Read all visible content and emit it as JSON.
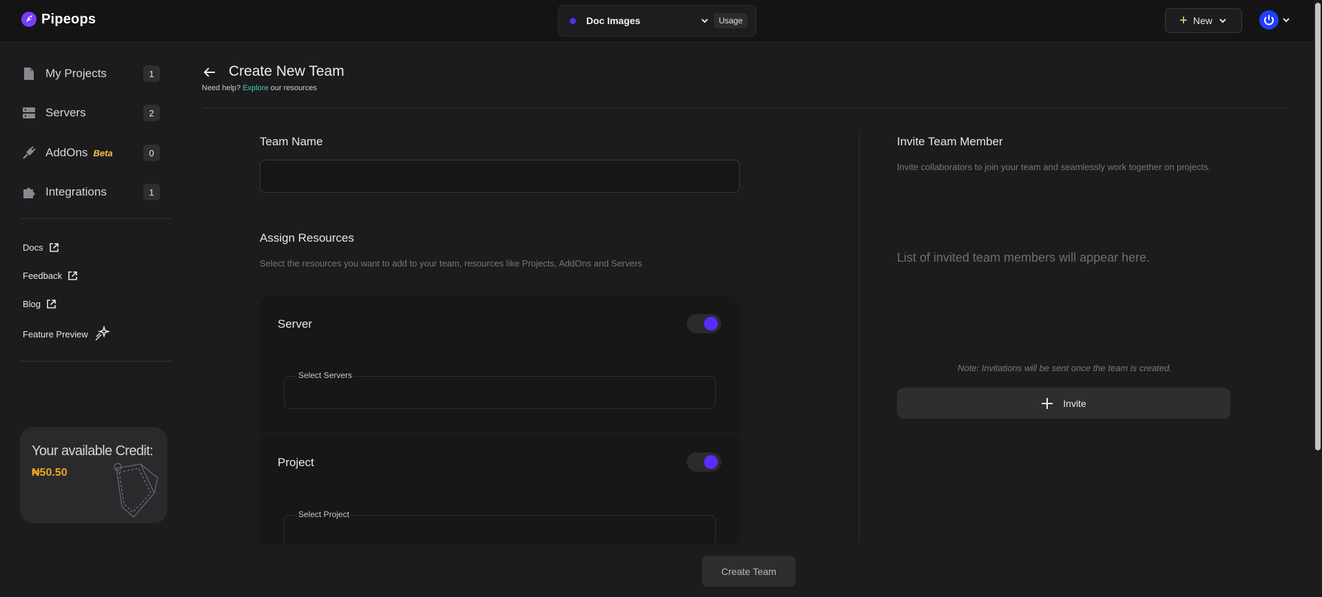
{
  "header": {
    "brand": "Pipeops",
    "project_switcher": {
      "name": "Doc Images",
      "usage_label": "Usage"
    },
    "new_button": "New"
  },
  "sidebar": {
    "nav": [
      {
        "label": "My Projects",
        "count": "1",
        "icon": "file-icon"
      },
      {
        "label": "Servers",
        "count": "2",
        "icon": "server-icon"
      },
      {
        "label": "AddOns",
        "badge": "Beta",
        "count": "0",
        "icon": "plug-icon"
      },
      {
        "label": "Integrations",
        "count": "1",
        "icon": "puzzle-icon"
      }
    ],
    "links": [
      {
        "label": "Docs",
        "icon": "external-link-icon"
      },
      {
        "label": "Feedback",
        "icon": "external-link-icon"
      },
      {
        "label": "Blog",
        "icon": "external-link-icon"
      },
      {
        "label": "Feature Preview",
        "icon": "sparkle-icon"
      }
    ],
    "credit": {
      "title": "Your available Credit:",
      "amount": "₦50.50"
    }
  },
  "page": {
    "title": "Create New Team",
    "help_prefix": "Need help?",
    "help_link": "Explore",
    "help_suffix": "our resources"
  },
  "team_form": {
    "team_name_label": "Team Name",
    "team_name_value": "",
    "assign_title": "Assign Resources",
    "assign_subtitle": "Select the resources you want to add to your team, resources like Projects, AddOns and Servers",
    "resources": [
      {
        "title": "Server",
        "select_label": "Select Servers",
        "enabled": true
      },
      {
        "title": "Project",
        "select_label": "Select Project",
        "enabled": true
      }
    ]
  },
  "invite": {
    "title": "Invite Team Member",
    "subtitle": "Invite collaborators to join your team and seamlessly work together on projects.",
    "empty_text": "List of invited team members will appear here.",
    "note": "Note: Invitations will be sent once the team is created.",
    "button": "Invite"
  },
  "footer": {
    "create_button": "Create Team"
  },
  "colors": {
    "accent": "#5b2bff",
    "link": "#3fd3b8",
    "credit": "#f0a81c",
    "beta": "#f4c542"
  }
}
